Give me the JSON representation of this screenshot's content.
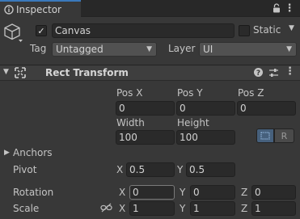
{
  "tab": {
    "label": "Inspector"
  },
  "header": {
    "active": true,
    "name": "Canvas",
    "static_label": "Static",
    "tag_label": "Tag",
    "tag_value": "Untagged",
    "layer_label": "Layer",
    "layer_value": "UI"
  },
  "component": {
    "title": "Rect Transform",
    "pos_x_label": "Pos X",
    "pos_y_label": "Pos Y",
    "pos_z_label": "Pos Z",
    "pos_x": "0",
    "pos_y": "0",
    "pos_z": "0",
    "width_label": "Width",
    "height_label": "Height",
    "width": "100",
    "height": "100",
    "raw_label": "R",
    "anchors_label": "Anchors",
    "pivot_label": "Pivot",
    "pivot_x_label": "X",
    "pivot_x": "0.5",
    "pivot_y_label": "Y",
    "pivot_y": "0.5",
    "rotation_label": "Rotation",
    "rot_x_label": "X",
    "rot_x": "0",
    "rot_y_label": "Y",
    "rot_y": "0",
    "rot_z_label": "Z",
    "rot_z": "0",
    "scale_label": "Scale",
    "scale_x_label": "X",
    "scale_x": "1",
    "scale_y_label": "Y",
    "scale_y": "1",
    "scale_z_label": "Z",
    "scale_z": "1"
  },
  "colors": {
    "panel_bg": "#383838",
    "field_bg": "#2a2a2a",
    "accent": "#3a79bb"
  }
}
